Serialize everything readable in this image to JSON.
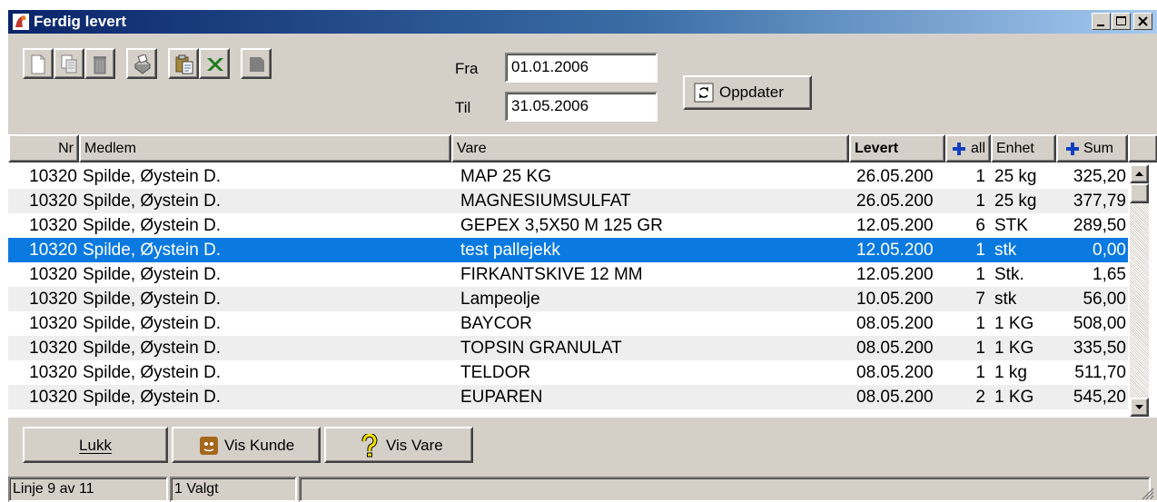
{
  "window": {
    "title": "Ferdig levert"
  },
  "filter": {
    "from_label": "Fra",
    "from_value": "01.01.2006",
    "to_label": "Til",
    "to_value": "31.05.2006",
    "update_label": "Oppdater"
  },
  "toolbar": {
    "icons": [
      "new-document-icon",
      "copy-document-icon",
      "delete-icon",
      "print-icon",
      "clipboard-icon",
      "excel-icon",
      "disabled-icon"
    ]
  },
  "table": {
    "headers": {
      "nr": "Nr",
      "member": "Medlem",
      "product": "Vare",
      "delivered": "Levert",
      "count": "all",
      "unit": "Enhet",
      "sum": "Sum"
    },
    "rows": [
      {
        "nr": "10320",
        "member": "Spilde, Øystein D.",
        "product": "MAP 25 KG",
        "delivered": "26.05.200",
        "count": "1",
        "unit": "25 kg",
        "sum": "325,20"
      },
      {
        "nr": "10320",
        "member": "Spilde, Øystein D.",
        "product": "MAGNESIUMSULFAT",
        "delivered": "26.05.200",
        "count": "1",
        "unit": "25 kg",
        "sum": "377,79"
      },
      {
        "nr": "10320",
        "member": "Spilde, Øystein D.",
        "product": "GEPEX 3,5X50 M 125 GR",
        "delivered": "12.05.200",
        "count": "6",
        "unit": "STK",
        "sum": "289,50"
      },
      {
        "nr": "10320",
        "member": "Spilde, Øystein D.",
        "product": "test pallejekk",
        "delivered": "12.05.200",
        "count": "1",
        "unit": "stk",
        "sum": "0,00"
      },
      {
        "nr": "10320",
        "member": "Spilde, Øystein D.",
        "product": "FIRKANTSKIVE 12 MM",
        "delivered": "12.05.200",
        "count": "1",
        "unit": "Stk.",
        "sum": "1,65"
      },
      {
        "nr": "10320",
        "member": "Spilde, Øystein D.",
        "product": "Lampeolje",
        "delivered": "10.05.200",
        "count": "7",
        "unit": "stk",
        "sum": "56,00"
      },
      {
        "nr": "10320",
        "member": "Spilde, Øystein D.",
        "product": "BAYCOR",
        "delivered": "08.05.200",
        "count": "1",
        "unit": "1 KG",
        "sum": "508,00"
      },
      {
        "nr": "10320",
        "member": "Spilde, Øystein D.",
        "product": "TOPSIN GRANULAT",
        "delivered": "08.05.200",
        "count": "1",
        "unit": "1 KG",
        "sum": "335,50"
      },
      {
        "nr": "10320",
        "member": "Spilde, Øystein D.",
        "product": "TELDOR",
        "delivered": "08.05.200",
        "count": "1",
        "unit": "1 kg",
        "sum": "511,70"
      },
      {
        "nr": "10320",
        "member": "Spilde, Øystein D.",
        "product": "EUPAREN",
        "delivered": "08.05.200",
        "count": "2",
        "unit": "1 KG",
        "sum": "545,20"
      }
    ],
    "selected_index": 3
  },
  "actions": {
    "close_label": "Lukk",
    "show_customer_label": "Vis Kunde",
    "show_product_label": "Vis Vare"
  },
  "status": {
    "line": "Linje 9 av 11",
    "selected": "1 Valgt"
  },
  "colors": {
    "selection": "#0a7ae0",
    "title_gradient_start": "#0a246a",
    "title_gradient_end": "#a6caf0",
    "face": "#d4d0c8"
  }
}
